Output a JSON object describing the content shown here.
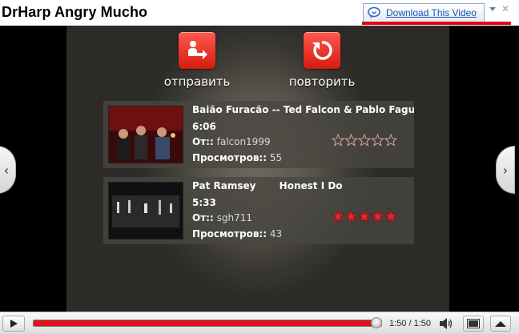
{
  "page": {
    "title": "DrHarp Angry Mucho"
  },
  "download": {
    "label": "Download This Video",
    "icon": "chat-bubble-icon",
    "brand_color": "#1a55b5",
    "underline_color": "#e3000f"
  },
  "end_screen": {
    "share_label": "отправить",
    "replay_label": "повторить",
    "related": [
      {
        "title": "Baião Furacão -- Ted Falcon & Pablo Fagundes",
        "duration": "6:06",
        "from_label": "От::",
        "author": "falcon1999",
        "views_label": "Просмотров::",
        "views": "55",
        "rating": 0
      },
      {
        "title": "Pat Ramsey       Honest I Do",
        "duration": "5:33",
        "from_label": "От::",
        "author": "sgh711",
        "views_label": "Просмотров::",
        "views": "43",
        "rating": 5
      }
    ]
  },
  "controls": {
    "time": "1:50 / 1:50",
    "progress": 1.0,
    "accent_color": "#e0121b"
  }
}
